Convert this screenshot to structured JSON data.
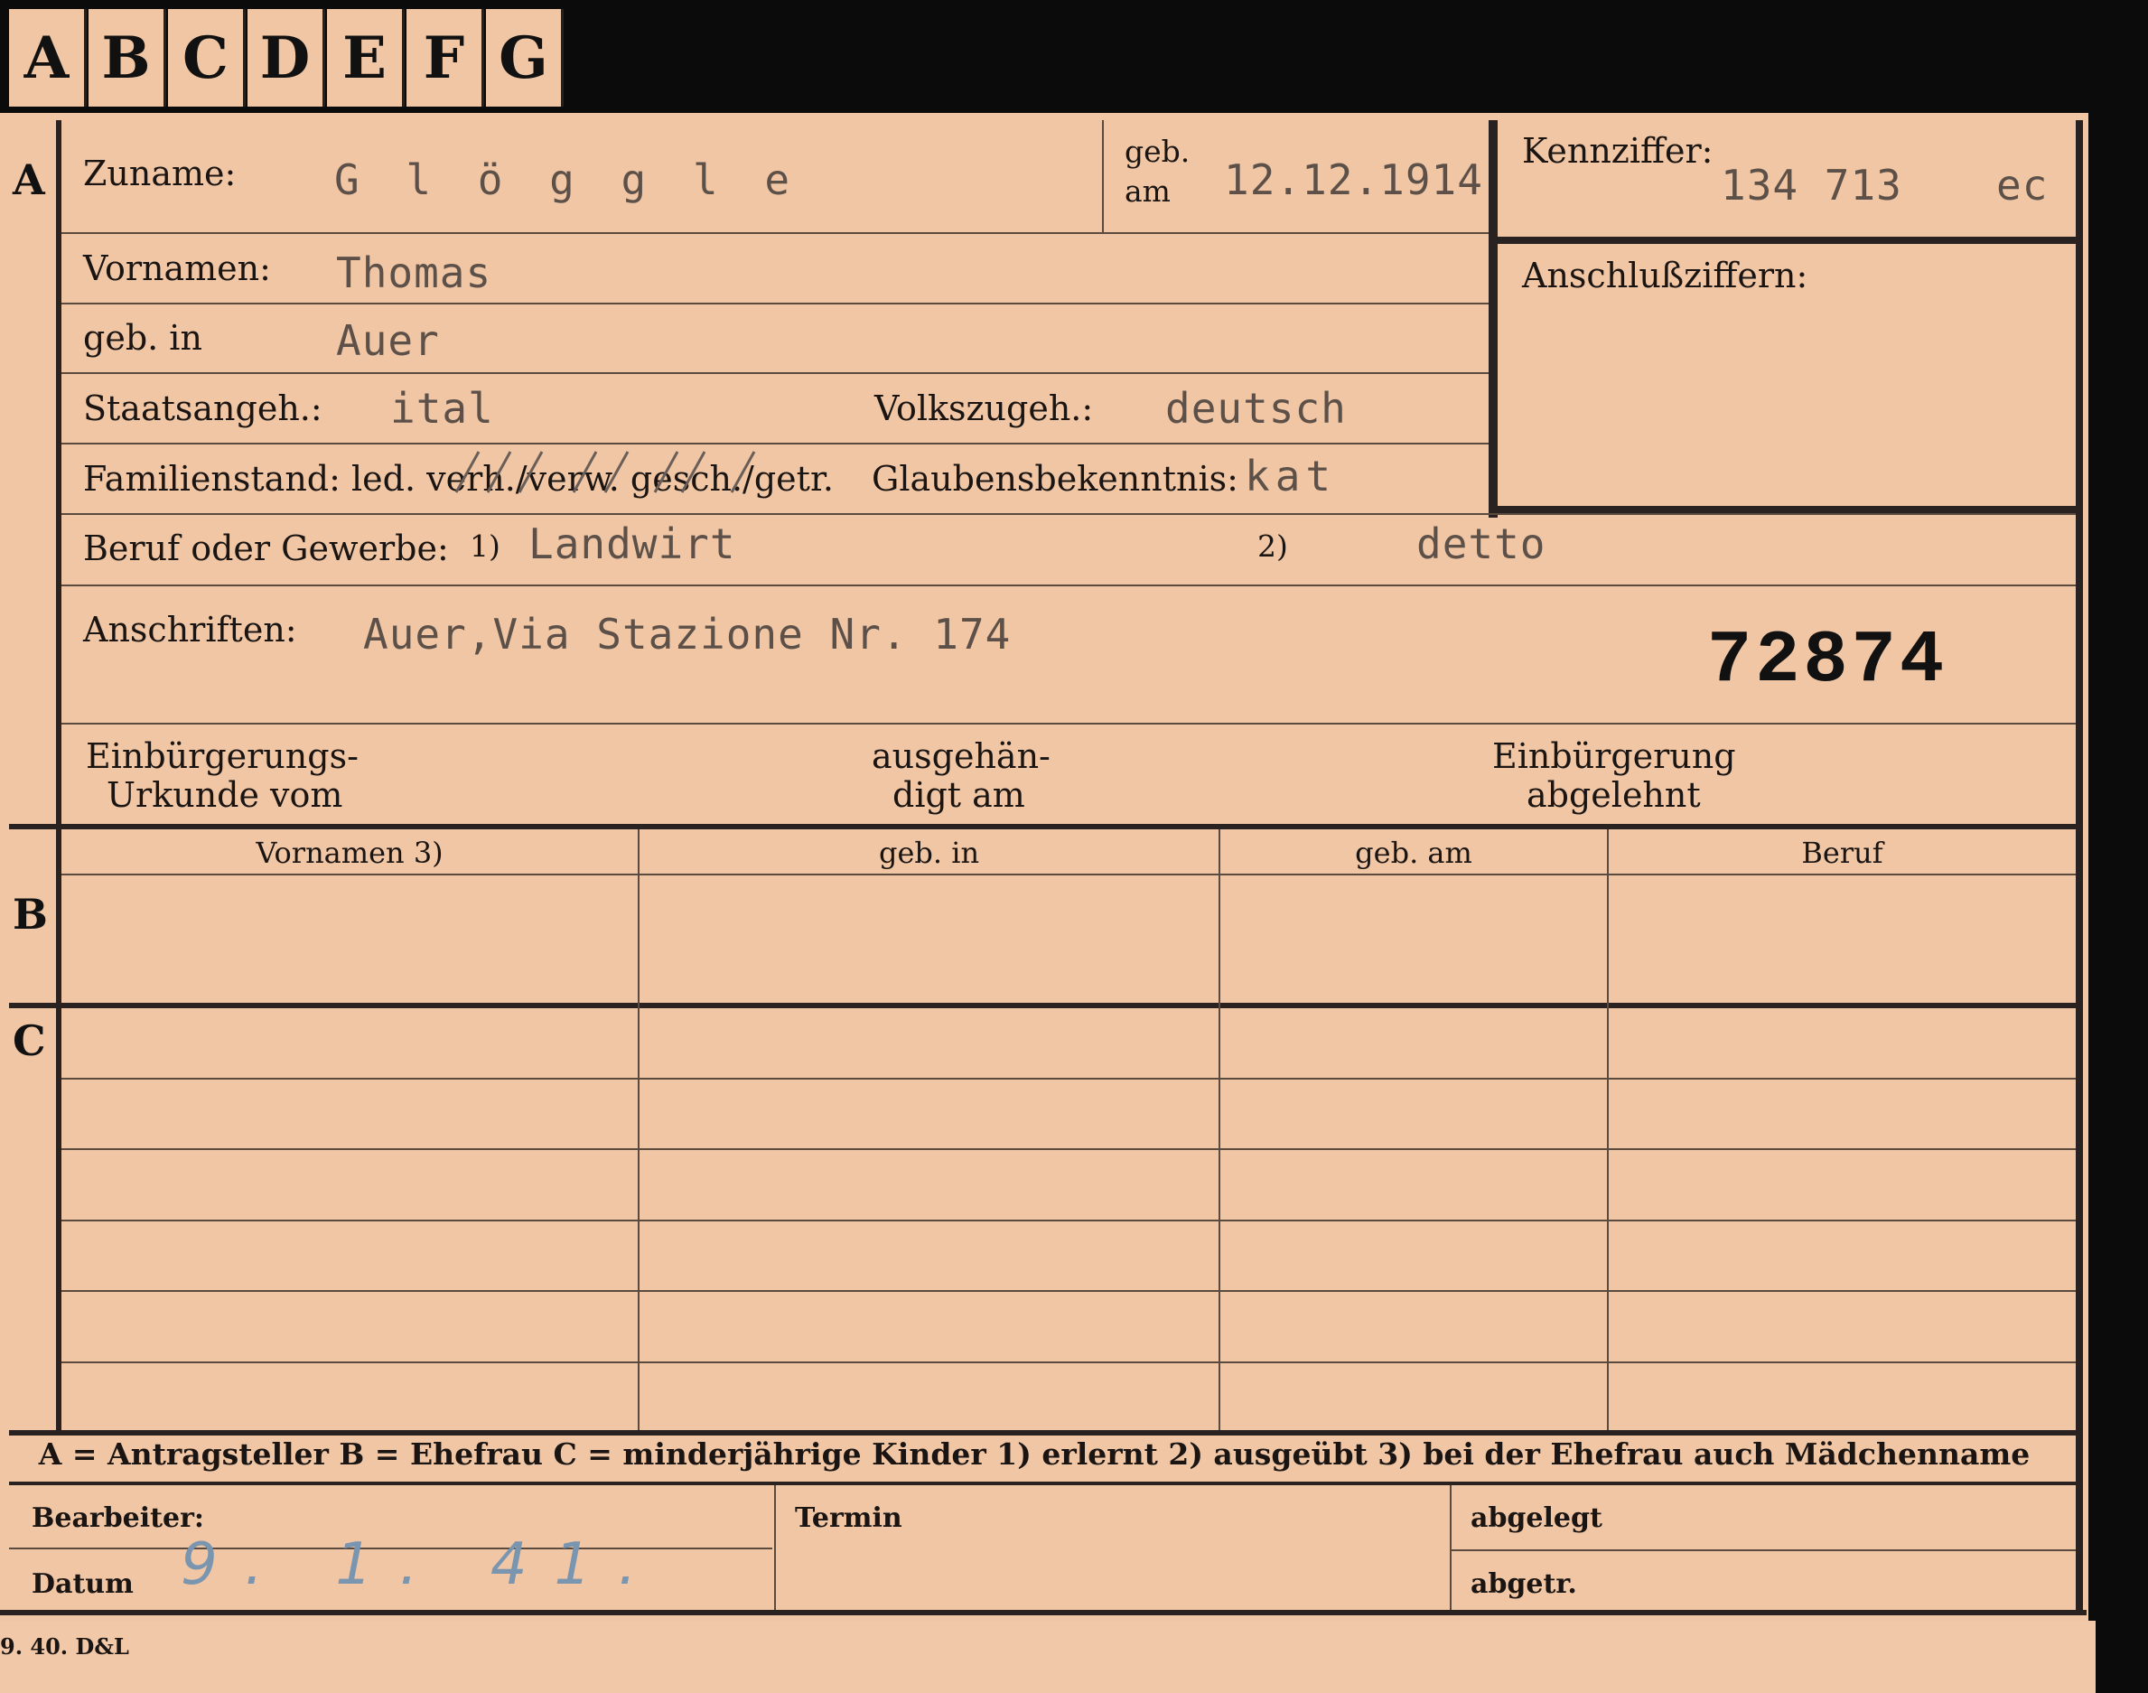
{
  "tabs": [
    "A",
    "B",
    "C",
    "D",
    "E",
    "F",
    "G"
  ],
  "section_markers": {
    "a": "A",
    "b": "B",
    "c": "C"
  },
  "labels": {
    "zuname": "Zuname:",
    "geb_am_1": "geb.",
    "geb_am_2": "am",
    "kennziffer": "Kennziffer:",
    "anschlussziffern": "Anschlußziffern:",
    "vornamen": "Vornamen:",
    "geb_in": "geb. in",
    "staatsangeh": "Staatsangeh.:",
    "volkszugeh": "Volkszugeh.:",
    "familienstand": "Familienstand: led. verh./verw. gesch./getr.",
    "glaubensbekenntnis": "Glaubensbekenntnis:",
    "beruf": "Beruf oder Gewerbe:",
    "beruf_fn1": "1)",
    "beruf_fn2": "2)",
    "anschriften": "Anschriften:",
    "einb_urk_1": "Einbürgerungs-",
    "einb_urk_2": "Urkunde vom",
    "ausgeh_1": "ausgehän-",
    "ausgeh_2": "digt am",
    "einb_abg_1": "Einbürgerung",
    "einb_abg_2": "abgelehnt"
  },
  "values": {
    "zuname": "G l ö g g l e",
    "geb_am": "12.12.1914",
    "kennziffer": "134 713",
    "kennziffer_suffix": "ec",
    "vornamen": "Thomas",
    "geb_in": "Auer",
    "staatsangeh": "ital",
    "volkszugeh": "deutsch",
    "glaubensbekenntnis": "kat",
    "beruf_erlernt": "Landwirt",
    "beruf_ausgeuebt": "detto",
    "anschrift": "Auer,Via Stazione Nr. 174",
    "stamp_number": "72874",
    "datum": "9. 1. 41."
  },
  "table_headers": [
    "Vornamen 3)",
    "geb. in",
    "geb. am",
    "Beruf"
  ],
  "legend": "A = Antragsteller   B = Ehefrau   C = minderjährige Kinder   1) erlernt   2) ausgeübt   3) bei der Ehefrau auch Mädchenname",
  "footer": {
    "bearbeiter": "Bearbeiter:",
    "datum": "Datum",
    "termin": "Termin",
    "abgelegt": "abgelegt",
    "abgetr": "abgetr."
  },
  "print_mark": "9. 40. D&L"
}
